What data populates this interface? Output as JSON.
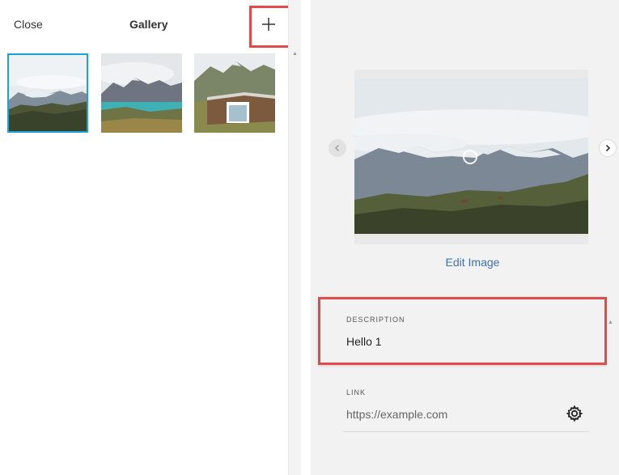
{
  "header": {
    "close_label": "Close",
    "title": "Gallery",
    "add_icon": "plus-icon"
  },
  "gallery": {
    "items": [
      {
        "scene": "mountain-meadow",
        "selected": true
      },
      {
        "scene": "mountain-lake",
        "selected": false
      },
      {
        "scene": "mountain-cabin",
        "selected": false
      }
    ],
    "selected_border_color": "#1aa3d4"
  },
  "editor": {
    "prev_icon": "chevron-left-icon",
    "next_icon": "chevron-right-icon",
    "edit_image_label": "Edit Image",
    "description": {
      "label": "DESCRIPTION",
      "value": "Hello 1"
    },
    "link": {
      "label": "LINK",
      "placeholder": "https://example.com",
      "settings_icon": "gear-icon"
    }
  },
  "colors": {
    "highlight": "#e14b4b",
    "link_blue": "#3e6fb5",
    "panel_bg": "#f2f2f2"
  }
}
